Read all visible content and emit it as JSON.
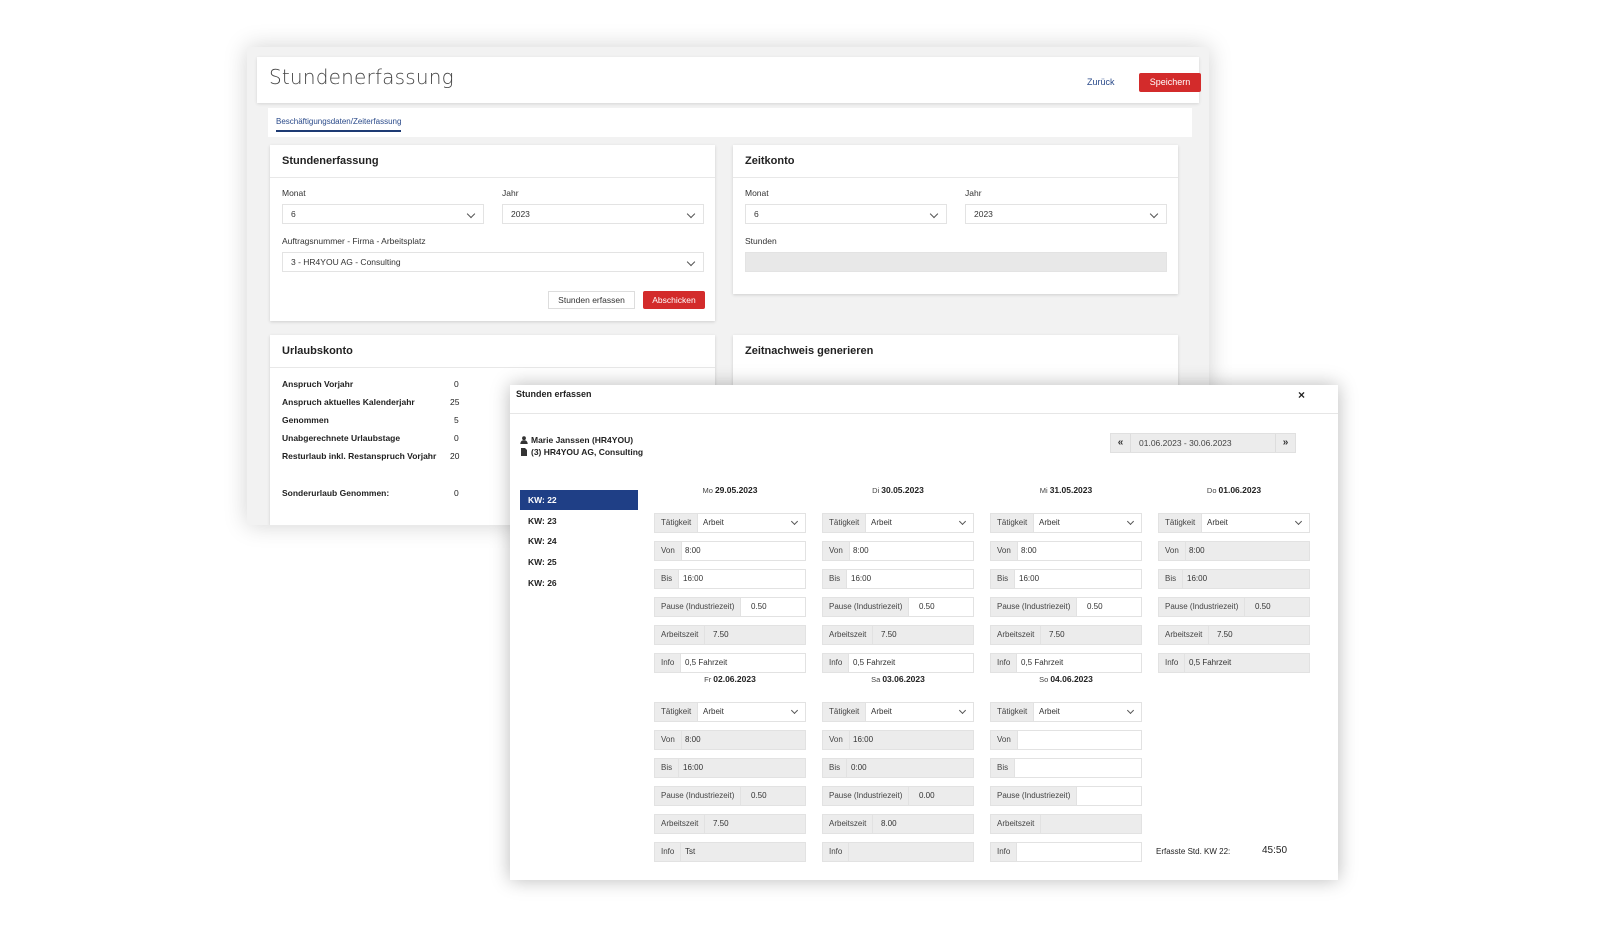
{
  "app": {
    "title": "Stundenerfassung",
    "back_label": "Zurück",
    "save_label": "Speichern",
    "tab_label": "Beschäftigungsdaten/Zeiterfassung"
  },
  "stundenerfassung_card": {
    "title": "Stundenerfassung",
    "monat_label": "Monat",
    "monat_value": "6",
    "jahr_label": "Jahr",
    "jahr_value": "2023",
    "auftrag_label": "Auftragsnummer - Firma - Arbeitsplatz",
    "auftrag_value": "3 - HR4YOU AG - Consulting",
    "stunden_button": "Stunden erfassen",
    "submit_button": "Abschicken"
  },
  "zeitkonto_card": {
    "title": "Zeitkonto",
    "monat_label": "Monat",
    "monat_value": "6",
    "jahr_label": "Jahr",
    "jahr_value": "2023",
    "stunden_label": "Stunden"
  },
  "urlaubskonto": {
    "title": "Urlaubskonto",
    "rows": [
      {
        "label": "Anspruch Vorjahr",
        "value": "0"
      },
      {
        "label": "Anspruch aktuelles Kalenderjahr",
        "value": "25"
      },
      {
        "label": "Genommen",
        "value": "5"
      },
      {
        "label": "Unabgerechnete Urlaubstage",
        "value": "0"
      },
      {
        "label": "Resturlaub inkl. Restanspruch Vorjahr",
        "value": "20"
      },
      {
        "label": "Sonderurlaub Genommen:",
        "value": "0"
      }
    ]
  },
  "zeitnachweis": {
    "title": "Zeitnachweis generieren"
  },
  "modal": {
    "title": "Stunden erfassen",
    "close": "×",
    "person": "Marie Janssen (HR4YOU)",
    "assignment": "(3) HR4YOU AG, Consulting",
    "range": "01.06.2023 - 30.06.2023",
    "prev": "«",
    "next": "»",
    "weeks": [
      "KW: 22",
      "KW: 23",
      "KW: 24",
      "KW: 25",
      "KW: 26"
    ],
    "field_labels": {
      "taetigkeit": "Tätigkeit",
      "von": "Von",
      "bis": "Bis",
      "pause": "Pause (Industriezeit)",
      "arbeitszeit": "Arbeitszeit",
      "info": "Info"
    },
    "days": [
      {
        "weekday": "Mo",
        "date": "29.05.2023",
        "taetigkeit": "Arbeit",
        "von": "8:00",
        "bis": "16:00",
        "pause": "0.50",
        "arbeitszeit": "7.50",
        "info": "0,5 Fahrzeit"
      },
      {
        "weekday": "Di",
        "date": "30.05.2023",
        "taetigkeit": "Arbeit",
        "von": "8:00",
        "bis": "16:00",
        "pause": "0.50",
        "arbeitszeit": "7.50",
        "info": "0,5 Fahrzeit"
      },
      {
        "weekday": "Mi",
        "date": "31.05.2023",
        "taetigkeit": "Arbeit",
        "von": "8:00",
        "bis": "16:00",
        "pause": "0.50",
        "arbeitszeit": "7.50",
        "info": "0,5 Fahrzeit"
      },
      {
        "weekday": "Do",
        "date": "01.06.2023",
        "taetigkeit": "Arbeit",
        "von": "8:00",
        "bis": "16:00",
        "pause": "0.50",
        "arbeitszeit": "7.50",
        "info": "0,5 Fahrzeit"
      },
      {
        "weekday": "Fr",
        "date": "02.06.2023",
        "taetigkeit": "Arbeit",
        "von": "8:00",
        "bis": "16:00",
        "pause": "0.50",
        "arbeitszeit": "7.50",
        "info": "Tst"
      },
      {
        "weekday": "Sa",
        "date": "03.06.2023",
        "taetigkeit": "Arbeit",
        "von": "16:00",
        "bis": "0:00",
        "pause": "0.00",
        "arbeitszeit": "8.00",
        "info": ""
      },
      {
        "weekday": "So",
        "date": "04.06.2023",
        "taetigkeit": "Arbeit",
        "von": "",
        "bis": "",
        "pause": "",
        "arbeitszeit": "",
        "info": ""
      }
    ],
    "summary_label": "Erfasste Std. KW 22:",
    "summary_value": "45:50"
  }
}
